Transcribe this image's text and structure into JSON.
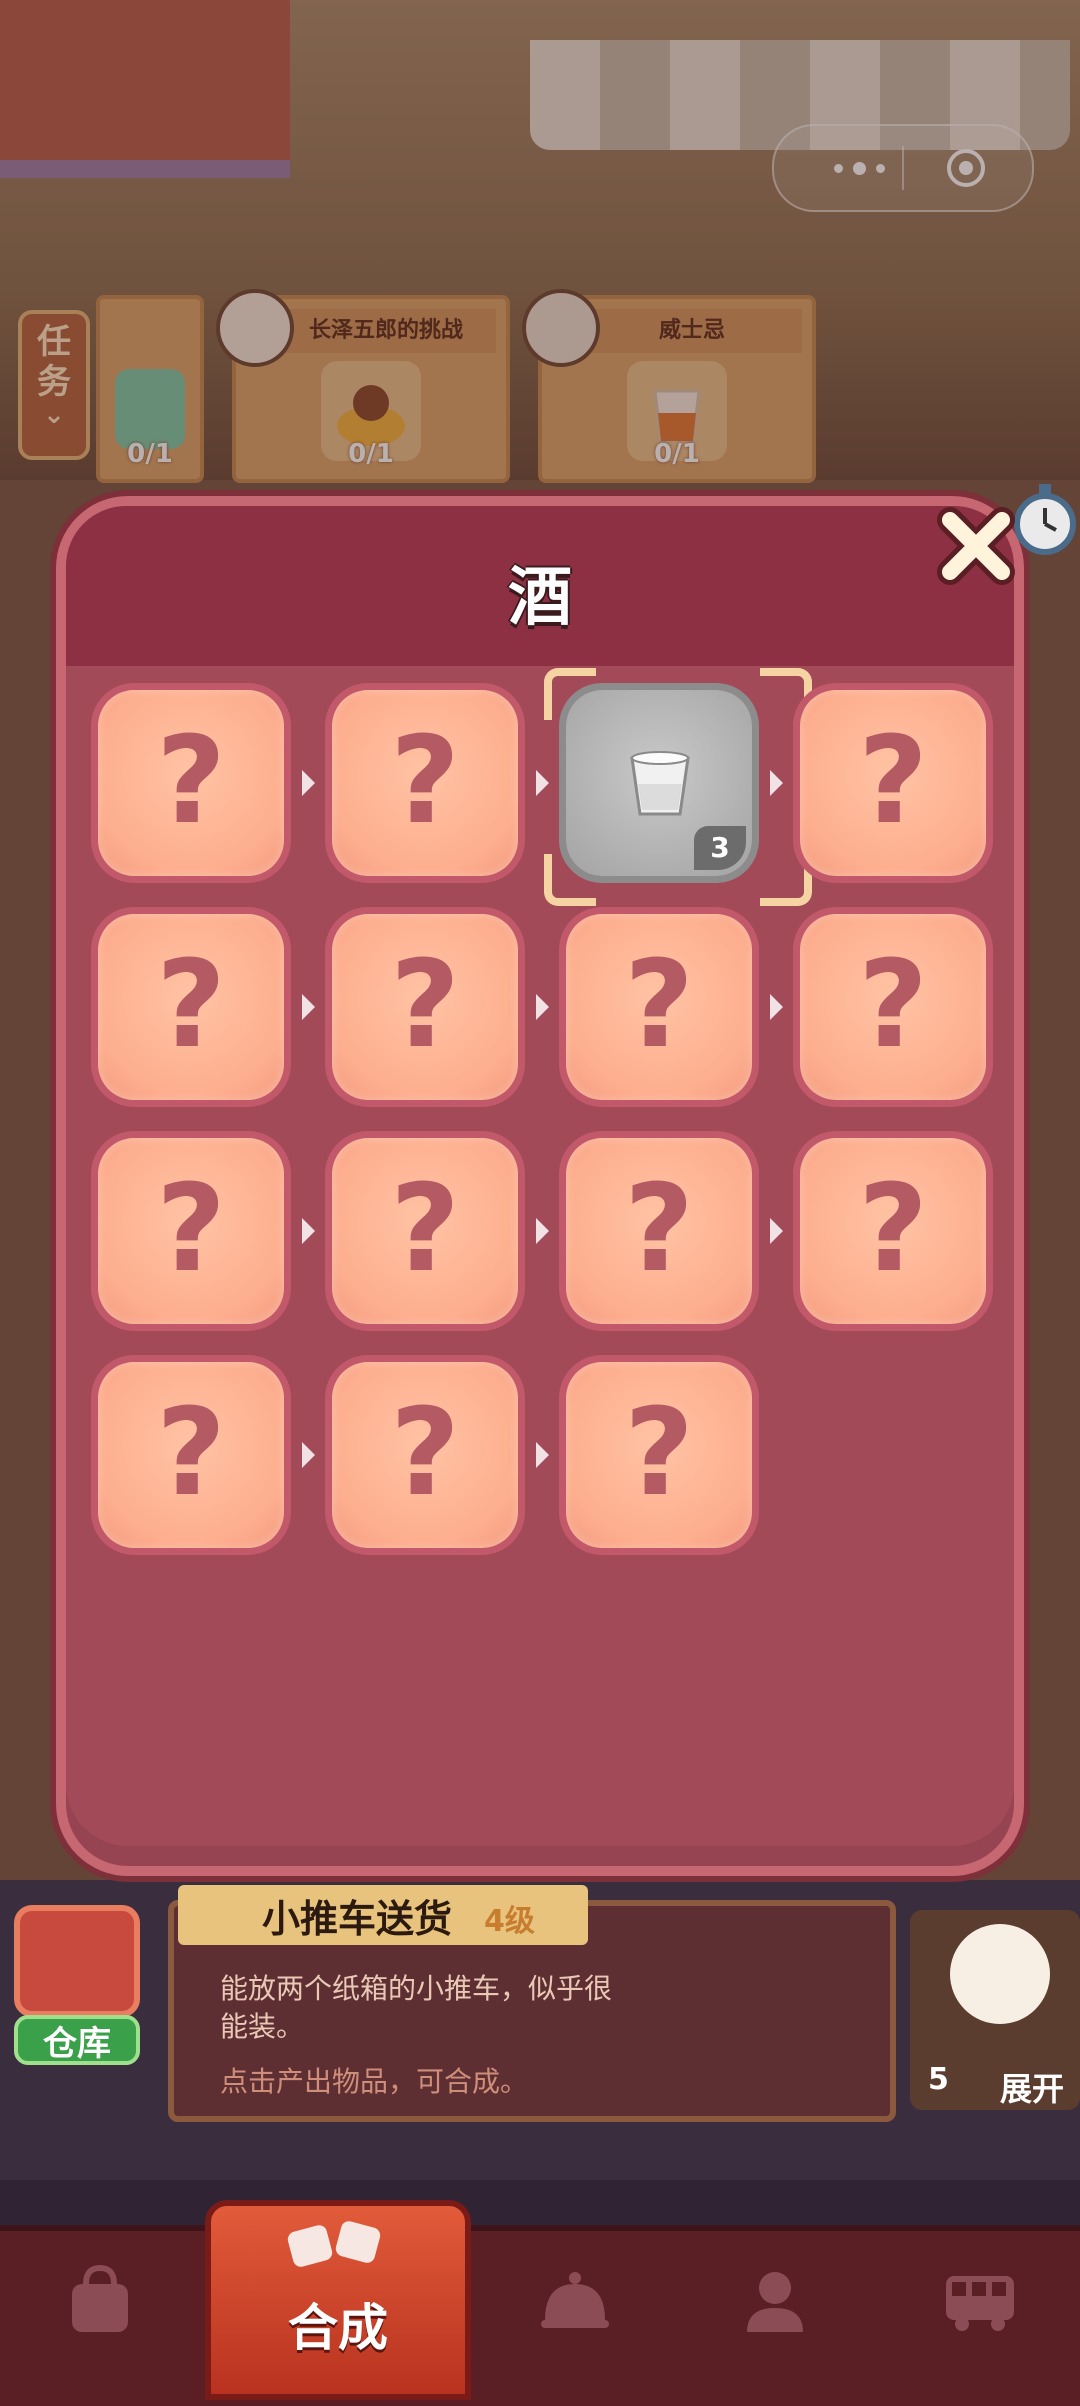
{
  "capsule": {
    "menu_icon": "more-dots-icon",
    "close_icon": "target-circle-icon"
  },
  "tasks": {
    "tab_label_1": "任",
    "tab_label_2": "务",
    "cards": [
      {
        "title": "",
        "progress": "0/1"
      },
      {
        "title": "长泽五郎的挑战",
        "progress": "0/1"
      },
      {
        "title": "威士忌",
        "progress": "0/1"
      }
    ]
  },
  "panel": {
    "title": "酒",
    "cells": [
      {
        "label": "?",
        "found": false
      },
      {
        "label": "?",
        "found": false
      },
      {
        "label": "",
        "found": true,
        "count": "3",
        "icon": "glass-icon"
      },
      {
        "label": "?",
        "found": false
      },
      {
        "label": "?",
        "found": false
      },
      {
        "label": "?",
        "found": false
      },
      {
        "label": "?",
        "found": false
      },
      {
        "label": "?",
        "found": false
      },
      {
        "label": "?",
        "found": false
      },
      {
        "label": "?",
        "found": false
      },
      {
        "label": "?",
        "found": false
      },
      {
        "label": "?",
        "found": false
      },
      {
        "label": "?",
        "found": false
      },
      {
        "label": "?",
        "found": false
      },
      {
        "label": "?",
        "found": false
      }
    ]
  },
  "info": {
    "title": "小推车送货",
    "level": "4级",
    "description": "能放两个纸箱的小推车，似乎很能装。",
    "hint": "点击产出物品，可合成。"
  },
  "warehouse": {
    "label": "仓库"
  },
  "cat": {
    "count": "5",
    "expand_label": "展开"
  },
  "nav": {
    "items": [
      {
        "icon": "bag-icon"
      },
      {
        "label": "合成",
        "icon": "merge-icon",
        "active": true
      },
      {
        "icon": "service-bell-icon"
      },
      {
        "icon": "person-icon"
      },
      {
        "icon": "bus-icon"
      }
    ]
  }
}
